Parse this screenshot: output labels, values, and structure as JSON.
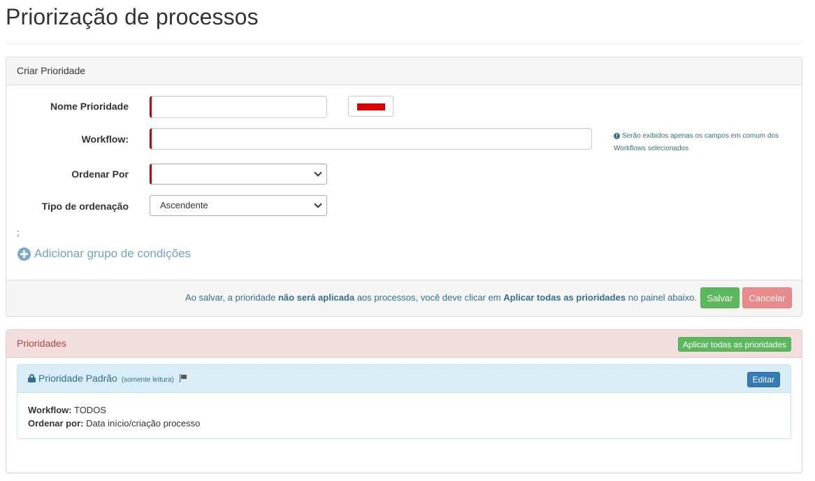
{
  "page": {
    "title": "Priorização de processos"
  },
  "create_panel": {
    "heading": "Criar Prioridade",
    "fields": {
      "name_label": "Nome Prioridade",
      "name_value": "",
      "color_value": "#e00000",
      "workflow_label": "Workflow:",
      "workflow_value": "",
      "order_by_label": "Ordenar Por",
      "order_by_value": "",
      "sort_type_label": "Tipo de ordenação",
      "sort_type_value": "Ascendente"
    },
    "help_text": "Serão exibidos apenas os campos em comum dos Workflows selecionados",
    "semicolon": ";",
    "add_group_label": "Adicionar grupo de condições",
    "footer": {
      "text_1": "Ao salvar, a prioridade ",
      "text_bold_1": "não será aplicada",
      "text_2": " aos processos, você deve clicar em ",
      "text_bold_2": "Aplicar todas as prioridades",
      "text_3": " no painel abaixo.",
      "save_label": "Salvar",
      "cancel_label": "Cancelar"
    }
  },
  "priorities_panel": {
    "heading": "Prioridades",
    "apply_all_label": "Aplicar todas as prioridades",
    "items": [
      {
        "title": "Prioridade Padrão",
        "readonly_note": "(somente leitura)",
        "edit_label": "Editar",
        "workflow_label": "Workflow:",
        "workflow_value": "TODOS",
        "order_label": "Ordenar por:",
        "order_value": "Data início/criação processo"
      }
    ]
  },
  "colors": {
    "save_green": "#5cb85c",
    "cancel_red": "#e8898a",
    "info_blue": "#31708f",
    "danger_heading": "#f2dede",
    "required_marker": "#cc0000"
  }
}
